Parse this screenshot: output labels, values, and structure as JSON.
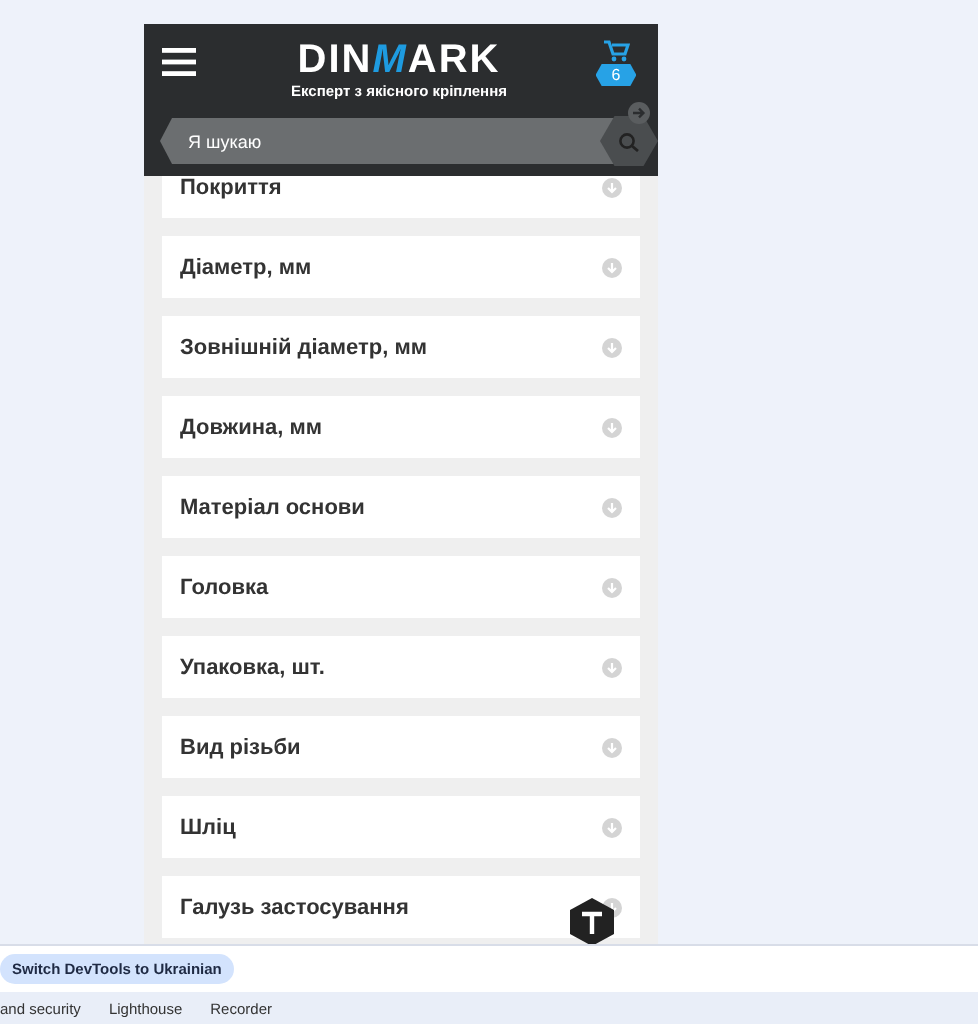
{
  "header": {
    "logo": [
      {
        "text": "DIN",
        "accent": false
      },
      {
        "text": "M",
        "accent": true
      },
      {
        "text": "ARK",
        "accent": false
      }
    ],
    "tagline": "Експерт з якісного кріплення",
    "cart_count": "6",
    "search": {
      "placeholder": "Я шукаю"
    }
  },
  "filters": [
    {
      "label": "Покриття",
      "expanded": false
    },
    {
      "label": "Діаметр, мм",
      "expanded": false
    },
    {
      "label": "Зовнішній діаметр, мм",
      "expanded": false
    },
    {
      "label": "Довжина, мм",
      "expanded": false
    },
    {
      "label": "Матеріал основи",
      "expanded": false
    },
    {
      "label": "Головка",
      "expanded": false
    },
    {
      "label": "Упаковка, шт.",
      "expanded": false
    },
    {
      "label": "Вид різьби",
      "expanded": false
    },
    {
      "label": "Шліц",
      "expanded": false
    },
    {
      "label": "Галузь застосування",
      "expanded": false
    }
  ],
  "devtools": {
    "language_button": "Switch DevTools to Ukrainian",
    "tabs": [
      "and security",
      "Lighthouse",
      "Recorder"
    ]
  }
}
